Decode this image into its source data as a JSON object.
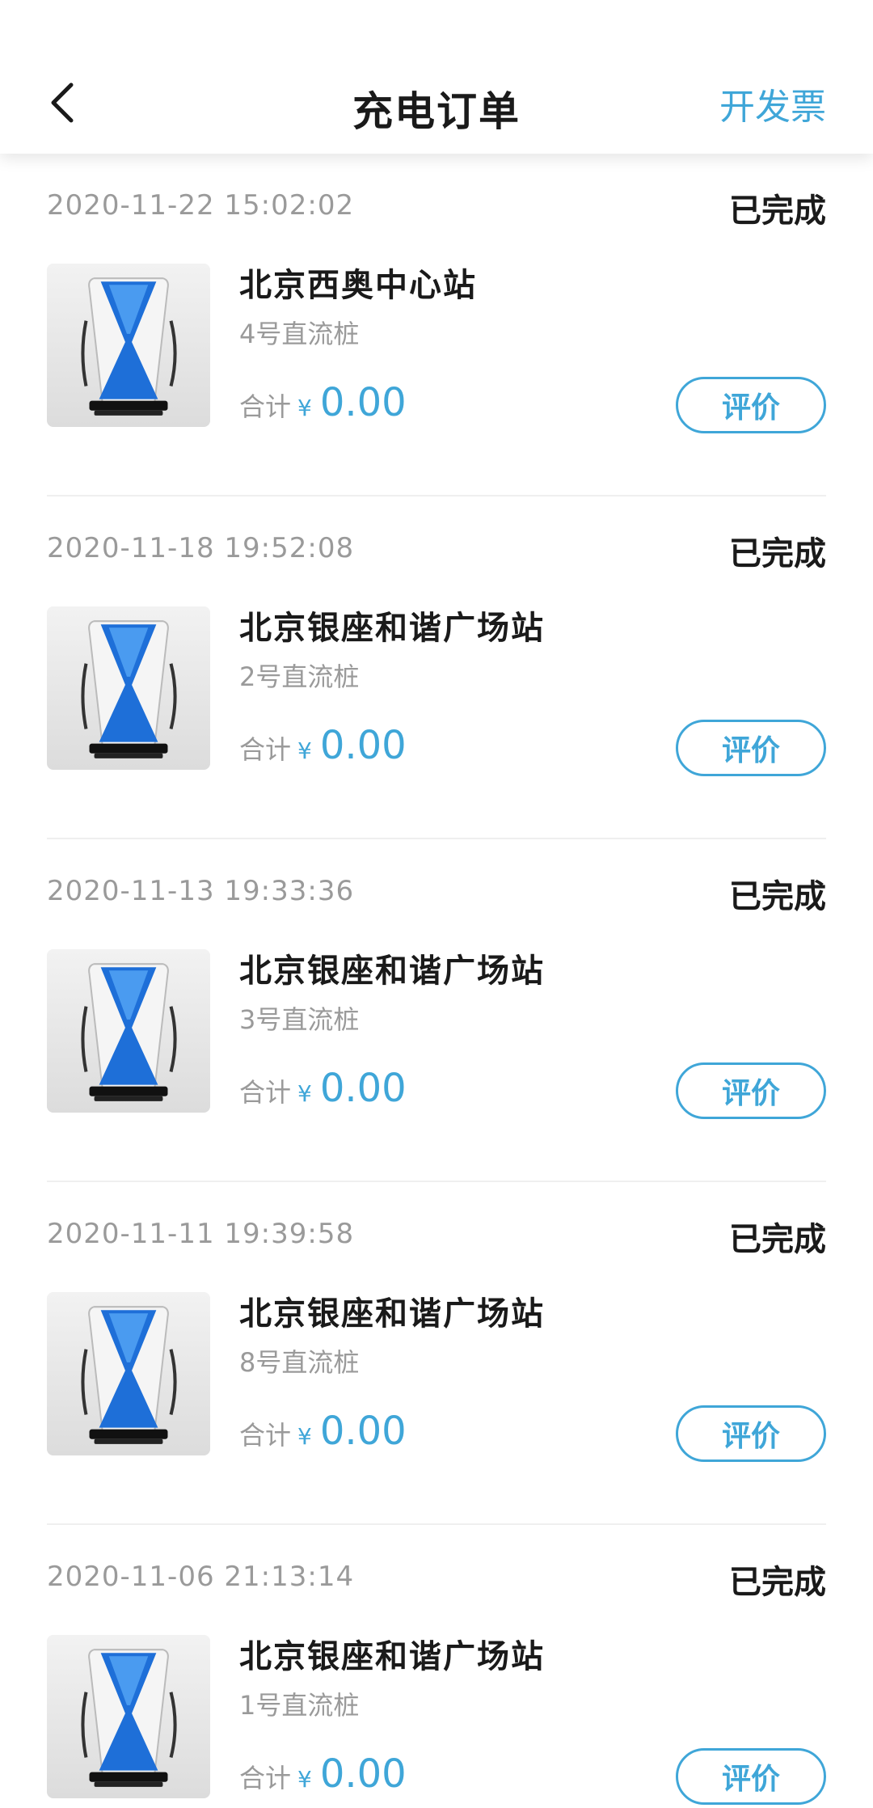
{
  "header": {
    "title": "充电订单",
    "invoice_label": "开发票"
  },
  "colors": {
    "accent": "#3fa6d8",
    "text_primary": "#1a1a1a",
    "text_secondary": "#9a9a9a"
  },
  "orders": [
    {
      "datetime": "2020-11-22 15:02:02",
      "status": "已完成",
      "station": "北京西奥中心站",
      "pile": "4号直流桩",
      "total_label": "合计",
      "currency": "¥",
      "amount": "0.00",
      "rate_label": "评价"
    },
    {
      "datetime": "2020-11-18 19:52:08",
      "status": "已完成",
      "station": "北京银座和谐广场站",
      "pile": "2号直流桩",
      "total_label": "合计",
      "currency": "¥",
      "amount": "0.00",
      "rate_label": "评价"
    },
    {
      "datetime": "2020-11-13 19:33:36",
      "status": "已完成",
      "station": "北京银座和谐广场站",
      "pile": "3号直流桩",
      "total_label": "合计",
      "currency": "¥",
      "amount": "0.00",
      "rate_label": "评价"
    },
    {
      "datetime": "2020-11-11 19:39:58",
      "status": "已完成",
      "station": "北京银座和谐广场站",
      "pile": "8号直流桩",
      "total_label": "合计",
      "currency": "¥",
      "amount": "0.00",
      "rate_label": "评价"
    },
    {
      "datetime": "2020-11-06 21:13:14",
      "status": "已完成",
      "station": "北京银座和谐广场站",
      "pile": "1号直流桩",
      "total_label": "合计",
      "currency": "¥",
      "amount": "0.00",
      "rate_label": "评价"
    }
  ],
  "icons": {
    "back": "chevron-left-icon",
    "thumbnail": "charging-pile-image"
  }
}
